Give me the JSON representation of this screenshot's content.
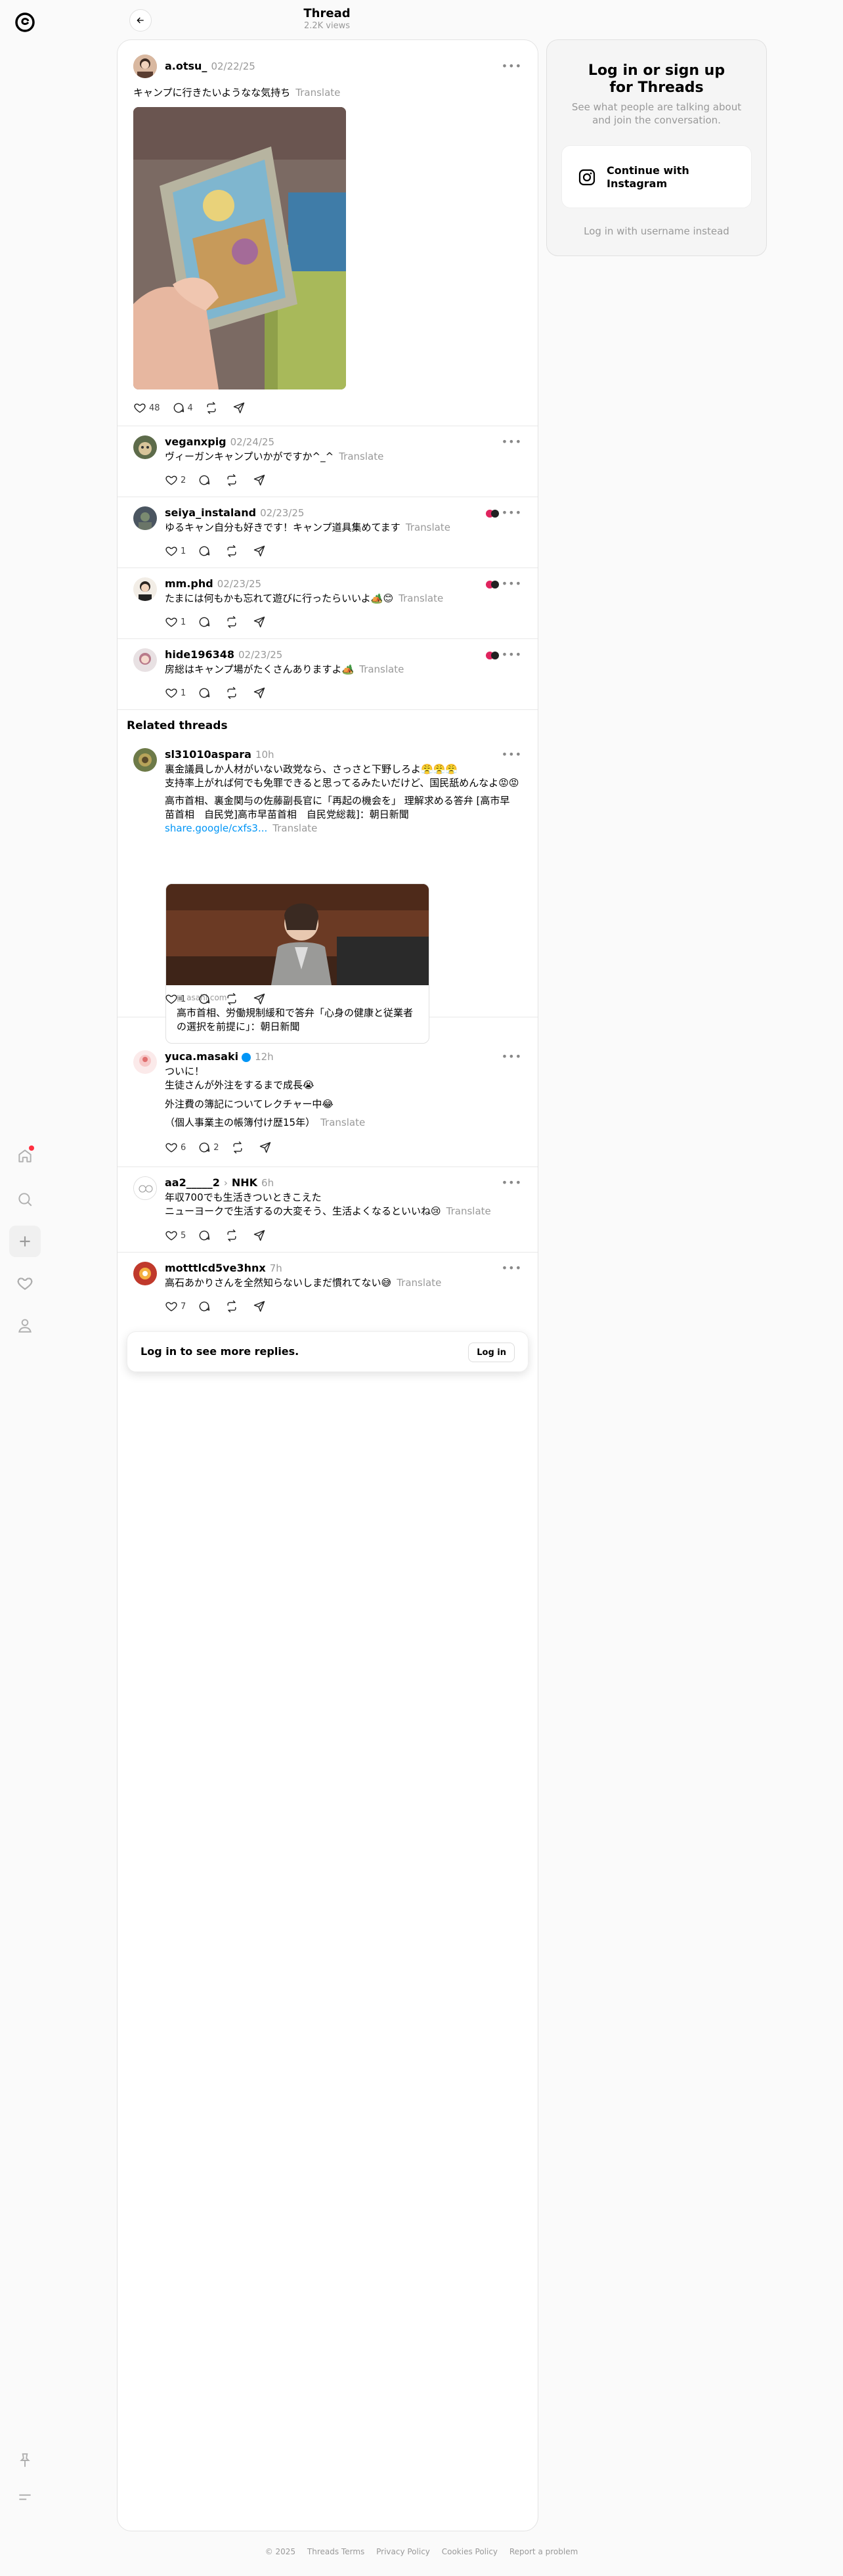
{
  "header": {
    "title": "Thread",
    "views": "2.2K views"
  },
  "main_post": {
    "username": "a.otsu_",
    "time": "02/22/25",
    "text": "キャンプに行きたいようなな気持ち",
    "translate": "Translate",
    "likes": "48",
    "replies": "4"
  },
  "replies": [
    {
      "username": "veganxpig",
      "time": "02/24/25",
      "text": "ヴィーガンキャンプいかがですか^_^",
      "translate": "Translate",
      "likes": "2"
    },
    {
      "username": "seiya_instaland",
      "time": "02/23/25",
      "text": "ゆるキャン自分も好きです！キャンプ道具集めてます",
      "translate": "Translate",
      "likes": "1"
    },
    {
      "username": "mm.phd",
      "time": "02/23/25",
      "text": "たまには何もかも忘れて遊びに行ったらいいよ🏕️😊",
      "translate": "Translate",
      "likes": "1"
    },
    {
      "username": "hide196348",
      "time": "02/23/25",
      "text": "房総はキャンプ場がたくさんありますよ🏕️",
      "translate": "Translate",
      "likes": "1"
    }
  ],
  "related": {
    "title": "Related threads",
    "posts": [
      {
        "username": "sl31010aspara",
        "time": "10h",
        "lines": [
          "裏金議員しか人材がいない政党なら、さっさと下野しろよ😤😤😤",
          "支持率上がれば何でも免罪できると思ってるみたいだけど、国民舐めんなよ😡😡"
        ],
        "lines2": [
          "高市首相、裏金関与の佐藤副長官に「再起の機会を」 理解求める答弁 [高市早",
          "苗首相　自民党]高市早苗首相　自民党総裁]：朝日新聞"
        ],
        "link": "share.google/cxfs3...",
        "translate": "Translate",
        "card_domain": "asahi.com",
        "card_title_1": "高市首相、労働規制緩和で答弁「心身の健康と従業者",
        "card_title_2": "の選択を前提に」：朝日新聞",
        "likes": "1"
      },
      {
        "username": "yuca.masaki",
        "time": "12h",
        "lines": [
          "ついに！",
          "生徒さんが外注をするまで成長😭"
        ],
        "line3": "外注費の簿記についてレクチャー中😂",
        "line4": "（個人事業主の帳簿付け歴15年）",
        "translate": "Translate",
        "likes": "6",
        "replies": "2"
      },
      {
        "username": "aa2_____2",
        "tag": "NHK",
        "time": "6h",
        "lines": [
          "年収700でも生活きついときこえた",
          "ニューヨークで生活するの大変そう、生活よくなるといいね😢"
        ],
        "translate": "Translate",
        "likes": "5"
      },
      {
        "username": "motttlcd5ve3hnx",
        "time": "7h",
        "lines": [
          "高石あかりさんを全然知らないしまだ慣れてない😅"
        ],
        "translate": "Translate",
        "likes": "7"
      }
    ]
  },
  "login_bar": {
    "text": "Log in to see more replies.",
    "button": "Log in"
  },
  "side_panel": {
    "title_1": "Log in or sign up",
    "title_2": "for Threads",
    "subtitle_1": "See what people are talking about",
    "subtitle_2": "and join the conversation.",
    "ig_button_1": "Continue with",
    "ig_button_2": "Instagram",
    "username_link": "Log in with username instead"
  },
  "footer": [
    "© 2025",
    "Threads Terms",
    "Privacy Policy",
    "Cookies Policy",
    "Report a problem"
  ],
  "icons": {
    "nav": [
      "threads-logo",
      "home-icon",
      "search-icon",
      "plus-icon",
      "heart-icon",
      "profile-icon",
      "pin-icon",
      "menu-icon"
    ],
    "accent": "#0095f6",
    "notification": "#ff3040"
  }
}
